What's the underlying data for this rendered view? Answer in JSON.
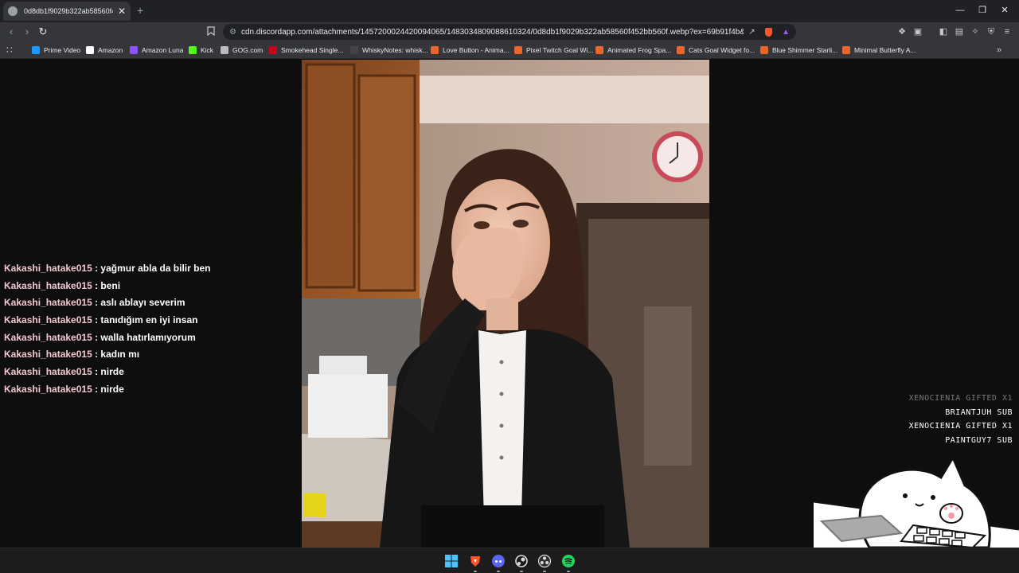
{
  "tab": {
    "title": "0d8db1f9029b322ab58560f452bb",
    "close": "✕"
  },
  "window": {
    "minimize": "—",
    "restore": "❐",
    "close": "✕",
    "new_tab": "+"
  },
  "address_bar": {
    "url": "cdn.discordapp.com/attachments/1457200024420094065/1483034809088610324/0d8db1f9029b322ab58560f452bb560f.webp?ex=69b91f4b&is=69..."
  },
  "bookmarks": [
    {
      "label": "Prime Video",
      "icon": "prime-video-icon",
      "color": "#1a98ff"
    },
    {
      "label": "Amazon",
      "icon": "amazon-icon",
      "color": "#ffffff"
    },
    {
      "label": "Amazon Luna",
      "icon": "amazon-luna-icon",
      "color": "#8c52ff"
    },
    {
      "label": "Kick",
      "icon": "kick-icon",
      "color": "#53fc18"
    },
    {
      "label": "GOG.com",
      "icon": "gog-icon",
      "color": "#bbbbbb"
    },
    {
      "label": "Smokehead Single...",
      "icon": "smokehead-icon",
      "color": "#d0021b"
    },
    {
      "label": "WhiskyNotes: whisk...",
      "icon": "whiskynotes-icon",
      "color": "#444444"
    },
    {
      "label": "Love Button - Anima...",
      "icon": "codepen-icon",
      "color": "#e8652b"
    },
    {
      "label": "Pixel Twitch Goal Wi...",
      "icon": "codepen-icon",
      "color": "#e8652b"
    },
    {
      "label": "Animated Frog Spa...",
      "icon": "codepen-icon",
      "color": "#e8652b"
    },
    {
      "label": "Cats Goal Widget fo...",
      "icon": "codepen-icon",
      "color": "#e8652b"
    },
    {
      "label": "Blue Shimmer Starli...",
      "icon": "codepen-icon",
      "color": "#e8652b"
    },
    {
      "label": "Minimal Butterfly A...",
      "icon": "codepen-icon",
      "color": "#e8652b"
    }
  ],
  "chat": [
    {
      "user": "Kakashi_hatake015",
      "message": "yağmur abla da bilir ben"
    },
    {
      "user": "Kakashi_hatake015",
      "message": "beni"
    },
    {
      "user": "Kakashi_hatake015",
      "message": "aslı ablayı severim"
    },
    {
      "user": "Kakashi_hatake015",
      "message": "tanıdığım en iyi insan"
    },
    {
      "user": "Kakashi_hatake015",
      "message": "walla hatırlamıyorum"
    },
    {
      "user": "Kakashi_hatake015",
      "message": "kadın mı"
    },
    {
      "user": "Kakashi_hatake015",
      "message": "nirde"
    },
    {
      "user": "Kakashi_hatake015",
      "message": "nirde"
    }
  ],
  "chat_separator": " : ",
  "alerts": [
    {
      "text": "XENOCIENIA GIFTED X1",
      "dim": true
    },
    {
      "text": "BRIANTJUH SUB",
      "dim": false
    },
    {
      "text": "XENOCIENIA GIFTED X1",
      "dim": false
    },
    {
      "text": "PAINTGUY7 SUB",
      "dim": false
    }
  ],
  "taskbar": [
    "windows-start-icon",
    "brave-icon",
    "discord-icon",
    "steam-icon",
    "obs-icon",
    "spotify-icon"
  ]
}
